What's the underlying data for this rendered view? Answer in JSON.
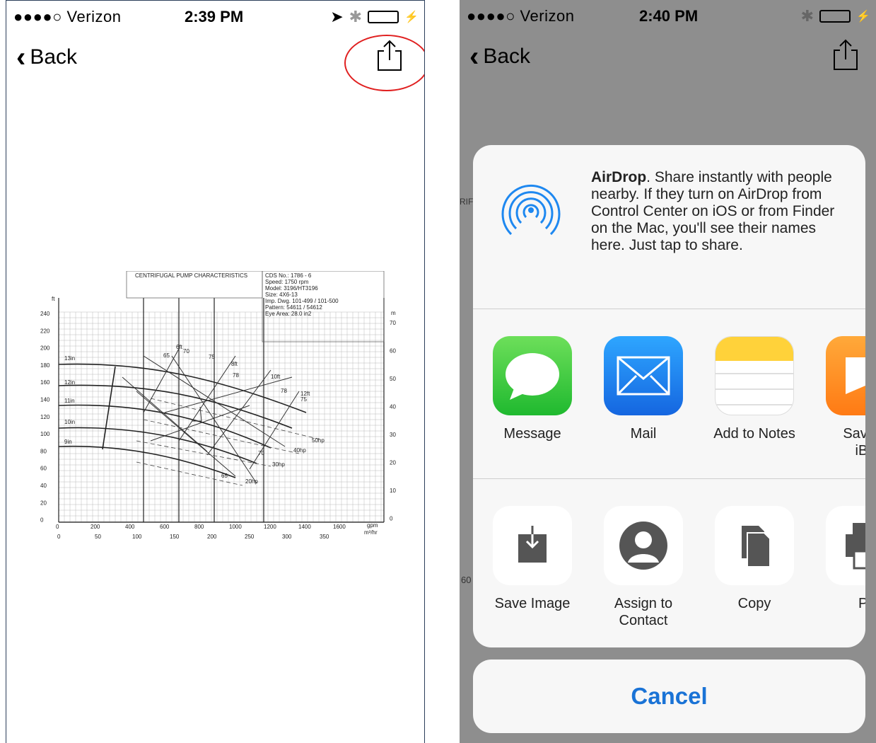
{
  "left_screen": {
    "status_bar": {
      "carrier": "●●●●○ Verizon",
      "time": "2:39 PM"
    },
    "nav": {
      "back_label": "Back"
    },
    "chart": {
      "title": "CENTRIFUGAL PUMP CHARACTERISTICS",
      "info_lines": [
        "CDS No.: 1786 - 6",
        "Speed: 1750 rpm",
        "Model: 3196/HT3196",
        "Size: 4X6-13",
        "Imp. Dwg. 101-499 / 101-500",
        "Pattern: 54611 / 54612",
        "Eye Area: 28.0 in2"
      ],
      "ft_label": "ft",
      "m_label": "m",
      "left_ticks": [
        "240",
        "220",
        "200",
        "180",
        "160",
        "140",
        "120",
        "100",
        "80",
        "60",
        "40",
        "20",
        "0"
      ],
      "right_ticks": [
        "70",
        "60",
        "50",
        "40",
        "30",
        "20",
        "10",
        "0"
      ],
      "gpm_ticks": [
        "0",
        "200",
        "400",
        "600",
        "800",
        "1000",
        "1200",
        "1400",
        "1600"
      ],
      "m3_ticks": [
        "0",
        "50",
        "100",
        "150",
        "200",
        "250",
        "300",
        "350"
      ],
      "gpm_label": "gpm",
      "m3_label": "m³/hr",
      "impeller_labels": [
        "13in",
        "12in",
        "11in",
        "10in",
        "9in"
      ],
      "hp_labels": [
        "50hp",
        "40hp",
        "30hp",
        "20hp"
      ],
      "npsh_labels": [
        "6ft",
        "8ft",
        "10ft",
        "12ft"
      ],
      "eff_labels": [
        "65",
        "70",
        "75",
        "78",
        "78",
        "75",
        "70",
        "65"
      ]
    }
  },
  "right_screen": {
    "status_bar": {
      "carrier": "●●●●○ Verizon",
      "time": "2:40 PM"
    },
    "nav": {
      "back_label": "Back"
    },
    "airdrop": {
      "title": "AirDrop",
      "text": ". Share instantly with people nearby. If they turn on AirDrop from Control Center on iOS or from Finder on the Mac, you'll see their names here. Just tap to share."
    },
    "apps": [
      {
        "label": "Message"
      },
      {
        "label": "Mail"
      },
      {
        "label": "Add to Notes"
      },
      {
        "label": "Save F\niBo"
      }
    ],
    "actions": [
      {
        "label": "Save Image"
      },
      {
        "label": "Assign to\nContact"
      },
      {
        "label": "Copy"
      },
      {
        "label": "Pr"
      }
    ],
    "cancel_label": "Cancel",
    "background_fragments": [
      "RIF",
      "60"
    ]
  },
  "colors": {
    "ios_blue": "#1a73d6",
    "highlight_red": "#e02020",
    "battery_green": "#33c946"
  }
}
